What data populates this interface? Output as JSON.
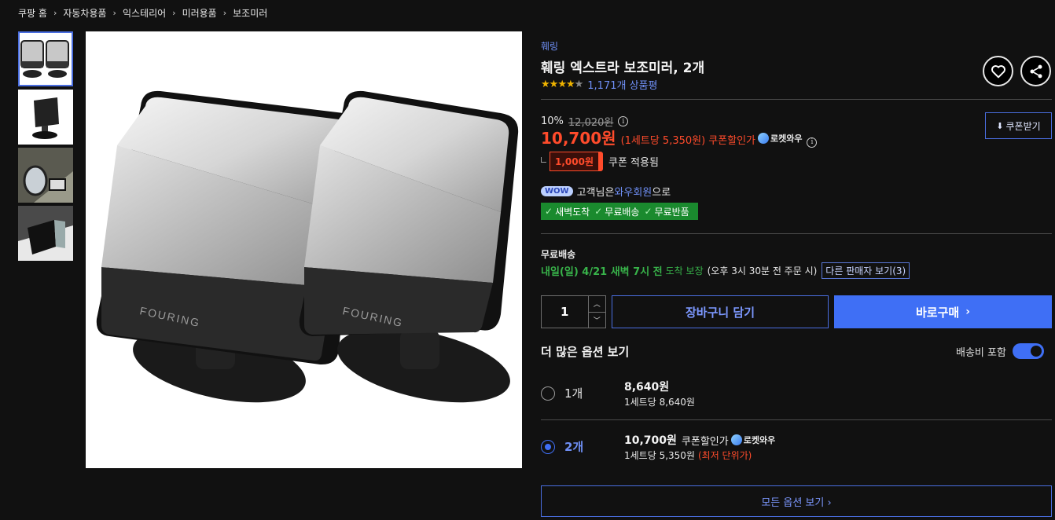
{
  "breadcrumb": [
    "쿠팡 홈",
    "자동차용품",
    "익스테리어",
    "미러용품",
    "보조미러"
  ],
  "product": {
    "brand": "훼링",
    "title": "훼링 엑스트라 보조미러, 2개",
    "rating": 4.5,
    "review_count": "1,171개 상품평",
    "image_logo_text": "FOURING"
  },
  "price": {
    "discount_rate": "10%",
    "original_price": "12,020원",
    "sale_price": "10,700원",
    "unit_price": "(1세트당 5,350원)",
    "coupon_label": "쿠폰할인가",
    "rocket_label": "로켓와우",
    "coupon_download": "쿠폰받기",
    "coupon_amount": "1,000원",
    "coupon_applied": "쿠폰 적용됨"
  },
  "wow": {
    "badge": "WOW",
    "prefix": "고객님은 ",
    "link": "와우회원",
    "suffix": "으로",
    "benefits": [
      "새벽도착",
      "무료배송",
      "무료반품"
    ]
  },
  "shipping": {
    "title": "무료배송",
    "arrival": "내일(일) 4/21 새벽 7시 전",
    "guarantee": "도착 보장",
    "note": "(오후 3시 30분 전 주문 시)",
    "other_sellers": "다른 판매자 보기(3)"
  },
  "purchase": {
    "quantity": "1",
    "cart_label": "장바구니 담기",
    "buy_label": "바로구매"
  },
  "options": {
    "title": "더 많은 옵션 보기",
    "shipping_included": "배송비 포함",
    "items": [
      {
        "name": "1개",
        "price": "8,640원",
        "coupon": "",
        "rocket": "",
        "unit": "1세트당 8,640원",
        "lowest": "",
        "selected": false
      },
      {
        "name": "2개",
        "price": "10,700원",
        "coupon": "쿠폰할인가",
        "rocket": "로켓와우",
        "unit": "1세트당 5,350원",
        "lowest": "(최저 단위가)",
        "selected": true
      }
    ],
    "all_options": "모든 옵션 보기 ›"
  },
  "colors": {
    "accent_blue": "#3f6ff5",
    "sale_red": "#ff4b2b",
    "rocket_green": "#38b34a",
    "star": "#f0b400"
  }
}
